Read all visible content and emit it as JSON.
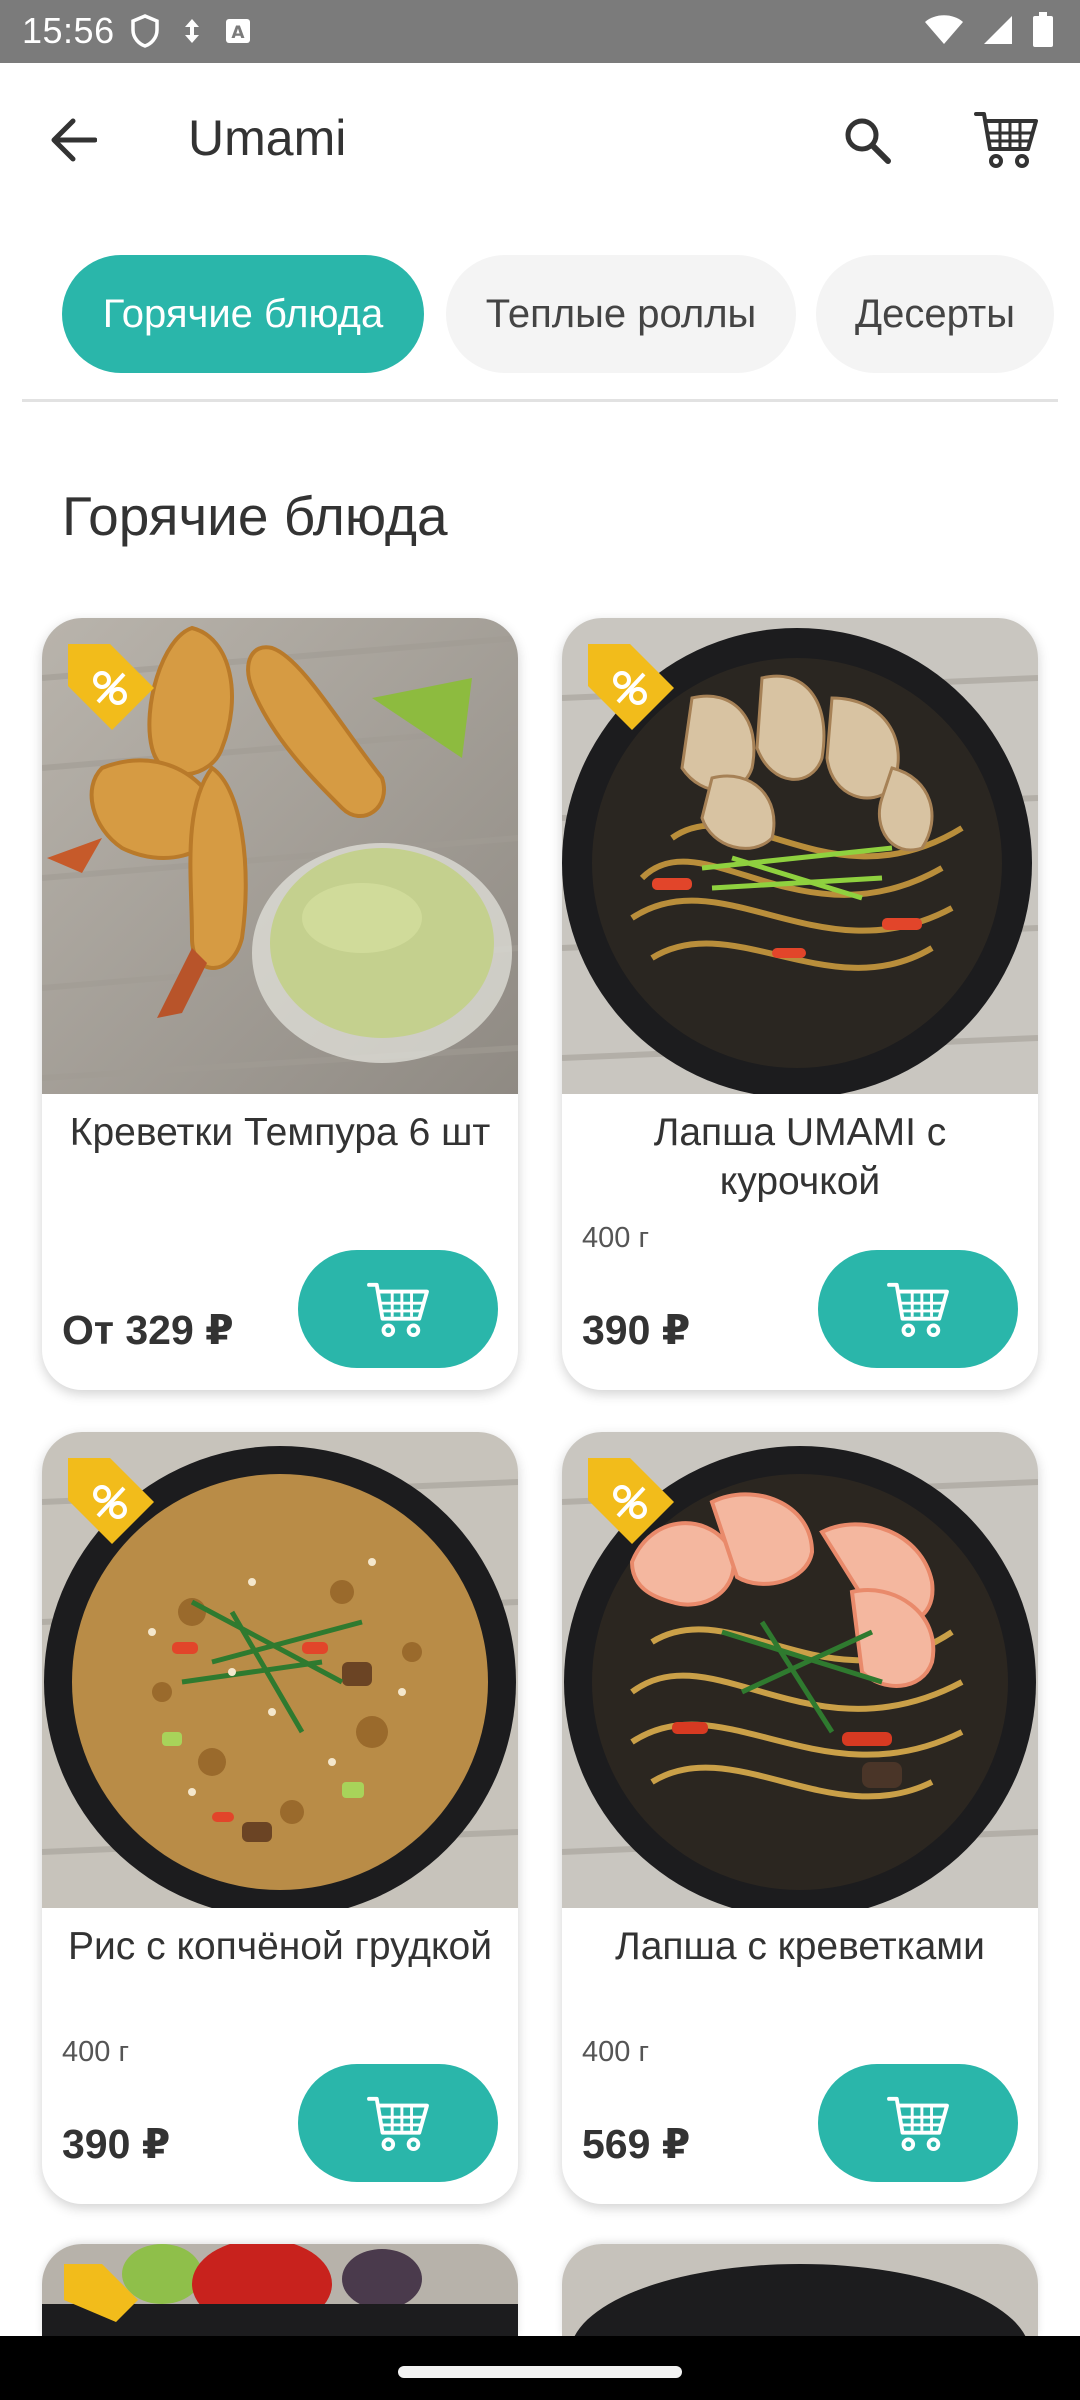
{
  "status_bar": {
    "time": "15:56"
  },
  "app_bar": {
    "title": "Umami",
    "icons": [
      "back-arrow-icon",
      "search-icon",
      "cart-icon"
    ]
  },
  "categories": [
    {
      "label": "Горячие блюда",
      "active": true
    },
    {
      "label": "Теплые роллы",
      "active": false
    },
    {
      "label": "Десерты",
      "active": false
    }
  ],
  "section": {
    "title": "Горячие блюда"
  },
  "products": [
    {
      "name": "Креветки Темпура 6 шт",
      "weight": "",
      "price": "От 329 ₽",
      "discount": true
    },
    {
      "name": "Лапша UMAMI с курочкой",
      "weight": "400 г",
      "price": "390 ₽",
      "discount": true
    },
    {
      "name": "Рис с копчёной грудкой",
      "weight": "400 г",
      "price": "390 ₽",
      "discount": true
    },
    {
      "name": "Лапша с креветками",
      "weight": "400 г",
      "price": "569 ₽",
      "discount": true
    }
  ],
  "colors": {
    "accent": "#2ab6aa",
    "discount_badge": "#f2bc1b",
    "status_bar": "#7b7b7b"
  }
}
